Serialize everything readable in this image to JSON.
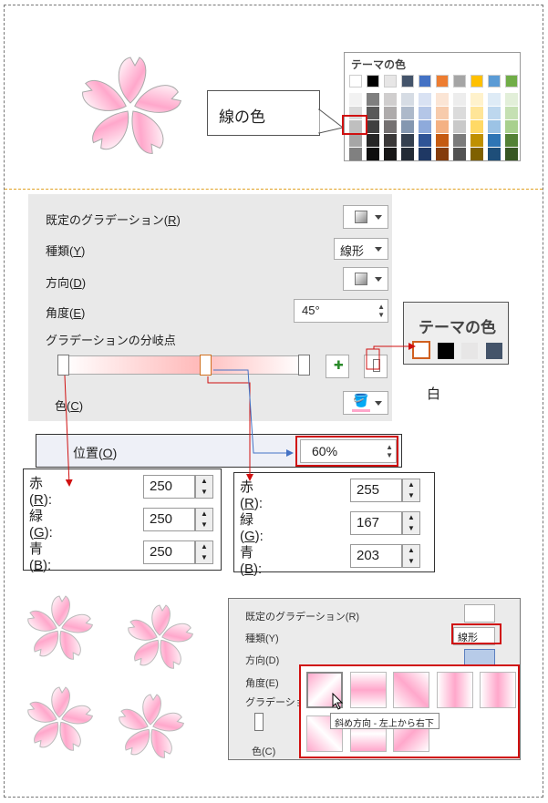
{
  "callout": {
    "label": "線の色"
  },
  "palette": {
    "title": "テーマの色",
    "top_row": [
      "#ffffff",
      "#000000",
      "#e7e6e6",
      "#44546a",
      "#4472c4",
      "#ed7d31",
      "#a5a5a5",
      "#ffc000",
      "#5b9bd5",
      "#70ad47"
    ],
    "selected": "white-lighter-15"
  },
  "panel": {
    "preset_label": "既定のグラデーション(",
    "preset_key": "R",
    "type_label": "種類(",
    "type_key": "Y",
    "type_value": "線形",
    "direction_label": "方向(",
    "direction_key": "D",
    "angle_label": "角度(",
    "angle_key": "E",
    "angle_value": "45°",
    "stops_label": "グラデーションの分岐点",
    "color_label": "色(",
    "color_key": "C",
    "close": ")"
  },
  "theme_zoom": {
    "title": "テーマの色",
    "swatches": [
      "#ffffff",
      "#000000",
      "#e7e6e6",
      "#44546a"
    ],
    "note": "白"
  },
  "position": {
    "label": "位置(",
    "key": "O",
    "close": ")",
    "value": "60%"
  },
  "rgb_left": {
    "rows": [
      {
        "label": "赤(",
        "key": "R",
        "tail": "):",
        "value": "250"
      },
      {
        "label": "緑(",
        "key": "G",
        "tail": "):",
        "value": "250"
      },
      {
        "label": "青(",
        "key": "B",
        "tail": "):",
        "value": "250"
      }
    ]
  },
  "rgb_right": {
    "rows": [
      {
        "label": "赤(",
        "key": "R",
        "tail": "):",
        "value": "255"
      },
      {
        "label": "緑(",
        "key": "G",
        "tail": "):",
        "value": "167"
      },
      {
        "label": "青(",
        "key": "B",
        "tail": "):",
        "value": "203"
      }
    ]
  },
  "panel2": {
    "preset": "既定のグラデーション(R)",
    "type": "種類(Y)",
    "type_value": "線形",
    "direction": "方向(D)",
    "angle": "角度(E)",
    "stops": "グラデーションの",
    "color": "色(C)",
    "tooltip": "斜め方向 - 左上から右下"
  },
  "colors": {
    "accent_red": "#d01010",
    "pink": "#ffa7cb",
    "blue_arrow": "#4472c4"
  }
}
